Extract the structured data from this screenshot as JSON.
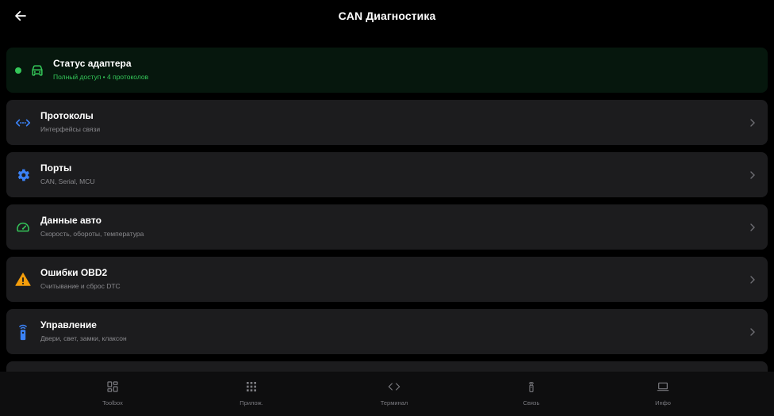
{
  "header": {
    "title": "CAN Диагностика",
    "back_icon": "arrow-left-icon"
  },
  "status_card": {
    "title": "Статус адаптера",
    "subtitle": "Полный доступ • 4 протоколов",
    "icon": "car-icon",
    "indicator_color": "#34c759"
  },
  "menu": [
    {
      "title": "Протоколы",
      "subtitle": "Интерфейсы связи",
      "icon": "code-arrows-icon",
      "icon_color": "#3b82f6"
    },
    {
      "title": "Порты",
      "subtitle": "CAN, Serial, MCU",
      "icon": "gear-icon",
      "icon_color": "#3b82f6"
    },
    {
      "title": "Данные авто",
      "subtitle": "Скорость, обороты, температура",
      "icon": "speedometer-icon",
      "icon_color": "#34c759"
    },
    {
      "title": "Ошибки OBD2",
      "subtitle": "Считывание и сброс DTC",
      "icon": "warning-icon",
      "icon_color": "#f59e0b"
    },
    {
      "title": "Управление",
      "subtitle": "Двери, свет, замки, клаксон",
      "icon": "remote-control-icon",
      "icon_color": "#3b82f6"
    }
  ],
  "bottom_nav": [
    {
      "label": "Toolbox",
      "icon": "dashboard-icon"
    },
    {
      "label": "Прилож.",
      "icon": "apps-grid-icon"
    },
    {
      "label": "Терминал",
      "icon": "code-icon"
    },
    {
      "label": "Связь",
      "icon": "remote-icon"
    },
    {
      "label": "Инфо",
      "icon": "laptop-icon"
    }
  ],
  "colors": {
    "background": "#000000",
    "card": "#1c1c1e",
    "status_card": "#06170d",
    "accent_green": "#34c759",
    "accent_blue": "#3b82f6",
    "accent_orange": "#f59e0b",
    "secondary_text": "#8a8a8e"
  }
}
